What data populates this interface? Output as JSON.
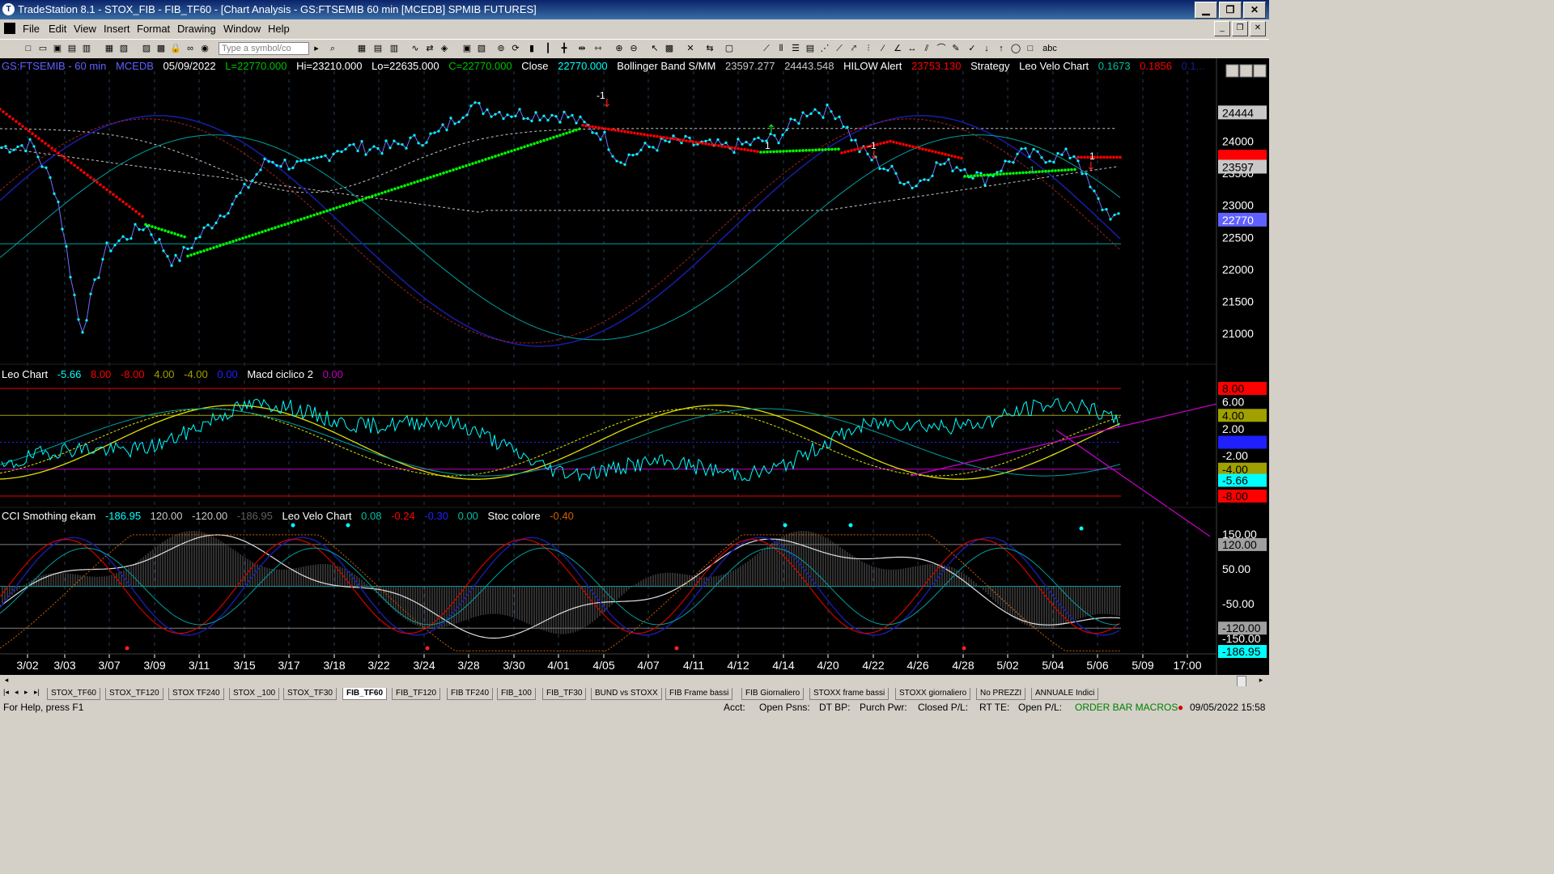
{
  "window": {
    "title": "TradeStation 8.1 - STOX_FIB - FIB_TF60 - [Chart Analysis - GS:FTSEMIB  60 min  [MCEDB] SPMIB FUTURES]",
    "app_icon": "tradestation-logo-icon",
    "minimize": "▁",
    "maximize": "❐",
    "close": "✕"
  },
  "menu": [
    "File",
    "Edit",
    "View",
    "Insert",
    "Format",
    "Drawing",
    "Window",
    "Help"
  ],
  "toolbar": {
    "symbol_placeholder": "Type a symbol/co",
    "text_tool": "abc"
  },
  "chart": {
    "header": {
      "symbol": "GS:FTSEMIB - 60 min",
      "exchange": "MCEDB",
      "date": "05/09/2022",
      "last": "L=22770.000",
      "high": "Hi=23210.000",
      "low": "Lo=22635.000",
      "close_val": "C=22770.000",
      "close_label": "Close",
      "close_value": "22770.000",
      "bollinger_label": "Bollinger Band S/MM",
      "bollinger_upper": "23597.277",
      "bollinger_lower": "24443.548",
      "hilow_label": "HILOW Alert",
      "hilow_value": "23753.130",
      "strategy_label": "Strategy",
      "velo_label": "Leo Velo Chart",
      "velo_v1": "0.1673",
      "velo_v2": "0.1856",
      "velo_v3": "0.1..."
    },
    "price_axis": [
      "24500",
      "24000",
      "23500",
      "23000",
      "22500",
      "22000",
      "21500",
      "21000"
    ],
    "price_tags": {
      "boll_upper": "24444",
      "hilow": "23753",
      "boll_mid": "23597",
      "last": "22770"
    },
    "leo_header": {
      "label": "Leo Chart",
      "v1": "-5.66",
      "v2": "8.00",
      "v3": "-8.00",
      "v4": "4.00",
      "v5": "-4.00",
      "v6": "0.00",
      "macd_label": "Macd ciclico 2",
      "macd_value": "0.00"
    },
    "leo_axis": [
      "8.00",
      "6.00",
      "4.00",
      "2.00",
      "0.00",
      "-2.00",
      "-4.00",
      "-5.66",
      "-8.00"
    ],
    "cci_header": {
      "label": "CCI Smothing ekam",
      "v1": "-186.95",
      "v2": "120.00",
      "v3": "-120.00",
      "v4": "-186.95",
      "velo_label": "Leo Velo Chart",
      "velo1": "0.08",
      "velo2": "-0.24",
      "velo3": "-0.30",
      "velo4": "0.00",
      "stoc_label": "Stoc colore",
      "stoc_value": "-0.40"
    },
    "cci_axis": [
      "150.00",
      "120.00",
      "50.00",
      "-50.00",
      "-120.00",
      "-150.00",
      "-186.95"
    ],
    "date_axis": [
      "3/02",
      "3/03",
      "3/07",
      "3/09",
      "3/11",
      "3/15",
      "3/17",
      "3/18",
      "3/22",
      "3/24",
      "3/28",
      "3/30",
      "4/01",
      "4/05",
      "4/07",
      "4/11",
      "4/12",
      "4/14",
      "4/20",
      "4/22",
      "4/26",
      "4/28",
      "5/02",
      "5/04",
      "5/06",
      "5/09",
      "17:00"
    ],
    "signal_labels": [
      "-1",
      "1",
      "-1",
      "1",
      "1",
      "-1"
    ],
    "colors": {
      "background": "#000000",
      "price": "#00ffff",
      "red_band": "#ff0000",
      "green_band": "#00ff00",
      "navy": "#1a1aa0",
      "yellow": "#e0e000",
      "magenta": "#c000c0",
      "gray": "#c8c8c8",
      "last_tag": "#6060ff",
      "header_green": "#00c000",
      "header_white": "#ffffff"
    }
  },
  "tabs": [
    "STOX_TF60",
    "STOX_TF120",
    "STOX TF240",
    "STOX _100",
    "STOX_TF30",
    "FIB_TF60",
    "FIB_TF120",
    "FIB TF240",
    "FIB_100",
    "FIB_TF30",
    "BUND vs STOXX",
    "FIB Frame bassi",
    "FIB Giornaliero",
    "STOXX frame bassi",
    "STOXX giornaliero",
    "No PREZZI",
    "ANNUALE Indici"
  ],
  "active_tab": "FIB_TF60",
  "status": {
    "help": "For Help, press F1",
    "acct": "Acct:",
    "open_psns": "Open Psns:",
    "dt_bp": "DT BP:",
    "purch_pwr": "Purch Pwr:",
    "closed_pl": "Closed P/L:",
    "rt_te": "RT TE:",
    "open_pl": "Open P/L:",
    "macros": "ORDER BAR MACROS",
    "datetime": "09/05/2022 15:58"
  }
}
